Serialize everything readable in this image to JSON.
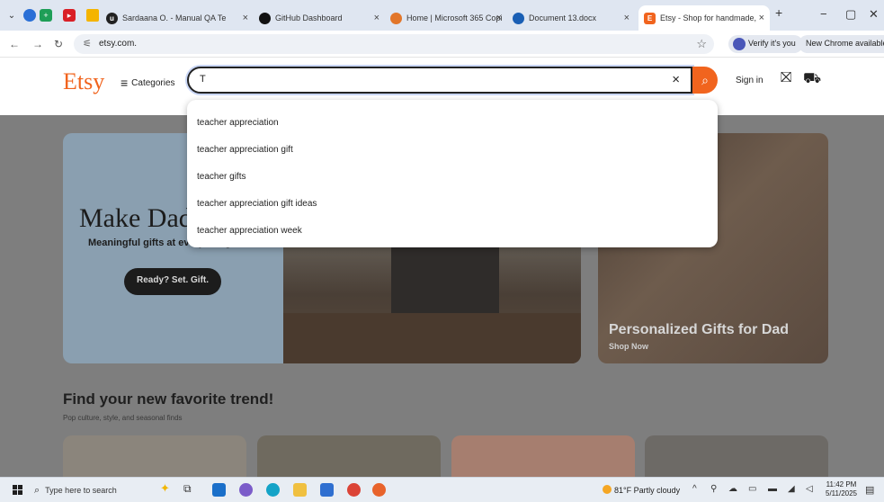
{
  "browser": {
    "tabs": [
      {
        "label": "Sardaana O. - Manual QA Te",
        "close": "×"
      },
      {
        "label": "GitHub Dashboard",
        "close": "×"
      },
      {
        "label": "Home | Microsoft 365 Copi",
        "close": "×"
      },
      {
        "label": "Document 13.docx",
        "close": "×"
      },
      {
        "label": "Etsy - Shop for handmade,",
        "close": "×"
      }
    ],
    "new_tab": "+",
    "minimize": "−",
    "maximize": "▢",
    "close": "✕",
    "url": "etsy.com.",
    "verify_label": "Verify it's you",
    "new_chrome_label": "New Chrome available"
  },
  "etsy": {
    "logo": "Etsy",
    "categories_label": "Categories",
    "search_value": "T",
    "sign_in": "Sign in",
    "suggestions": [
      "teacher appreciation",
      "teacher appreciation gift",
      "teacher gifts",
      "teacher appreciation gift ideas",
      "teacher appreciation week"
    ],
    "hero_title": "Make Dad",
    "hero_subtitle": "Meaningful gifts at every budget",
    "hero_button": "Ready? Set. Gift.",
    "side_title": "Personalized Gifts for Dad",
    "side_link": "Shop Now",
    "trend_title": "Find your new favorite trend!",
    "trend_subtitle": "Pop culture, style, and seasonal finds"
  },
  "taskbar": {
    "search_placeholder": "Type here to search",
    "weather": "81°F Partly cloudy",
    "time": "11:42 PM",
    "date": "5/11/2025"
  },
  "colors": {
    "etsy_orange": "#f1641e",
    "tab_strip": "#dfe6f1"
  }
}
